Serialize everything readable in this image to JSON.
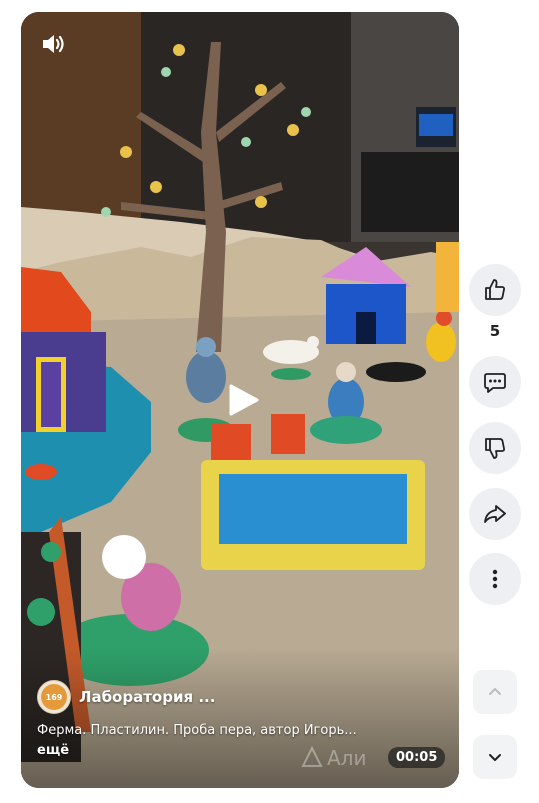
{
  "video": {
    "channel_name": "Лаборатория ...",
    "channel_avatar_text": "169",
    "description": "Ферма. Пластилин. Проба пера, автор Игорь...",
    "more_label": "ещё",
    "duration": "00:05",
    "watermark": "Али"
  },
  "actions": {
    "like_count": "5"
  },
  "icons": {
    "sound": "speaker-icon",
    "play": "play-icon",
    "like": "thumbs-up-icon",
    "comments": "comment-icon",
    "dislike": "thumbs-down-icon",
    "share": "share-icon",
    "more": "more-vertical-icon",
    "prev": "chevron-up-icon",
    "next": "chevron-down-icon"
  }
}
